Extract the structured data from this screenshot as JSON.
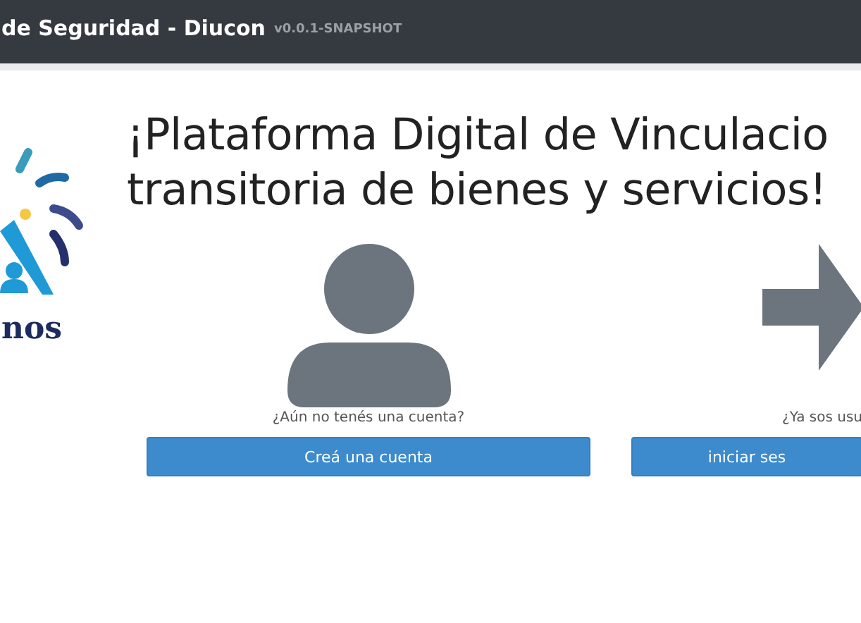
{
  "navbar": {
    "title": "de Seguridad - Diucon",
    "version": "v0.0.1-SNAPSHOT"
  },
  "logo": {
    "text": "nos"
  },
  "heading": {
    "lines": [
      "¡Plataforma Digital de Vinculacio",
      "transitoria de bienes y servicios!"
    ]
  },
  "options": [
    {
      "kind": "person",
      "caption": "¿Aún no tenés una cuenta?",
      "button": "Creá una cuenta"
    },
    {
      "kind": "arrow",
      "caption": "¿Ya sos usu",
      "button": "iniciar ses"
    }
  ]
}
